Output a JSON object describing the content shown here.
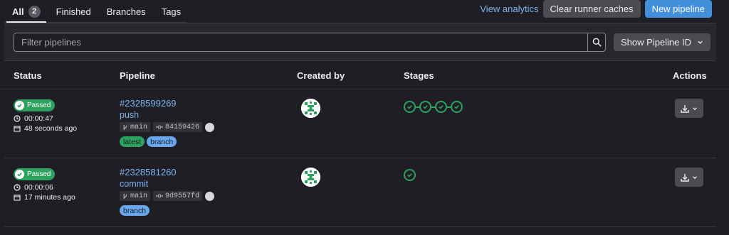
{
  "tabs": [
    {
      "label": "All",
      "count": "2"
    },
    {
      "label": "Finished"
    },
    {
      "label": "Branches"
    },
    {
      "label": "Tags"
    }
  ],
  "actions": {
    "view_analytics": "View analytics",
    "clear_caches": "Clear runner caches",
    "new_pipeline": "New pipeline"
  },
  "filter": {
    "placeholder": "Filter pipelines",
    "show_id_label": "Show Pipeline ID"
  },
  "table": {
    "headers": [
      "Status",
      "Pipeline",
      "Created by",
      "Stages",
      "Actions"
    ],
    "rows": [
      {
        "status": "Passed",
        "duration": "00:00:47",
        "finished": "48 seconds ago",
        "pipeline_id": "#2328599269",
        "source": "push",
        "ref": "main",
        "commit": "84159426",
        "tags": [
          "latest",
          "branch"
        ],
        "stages": 4
      },
      {
        "status": "Passed",
        "duration": "00:00:06",
        "finished": "17 minutes ago",
        "pipeline_id": "#2328581260",
        "source": "commit",
        "ref": "main",
        "commit": "9d9557fd",
        "tags": [
          "branch"
        ],
        "stages": 1
      }
    ]
  },
  "colors": {
    "background": "#1f1e24",
    "success": "#2da160",
    "link": "#7cb3f2",
    "primary": "#428fdc"
  },
  "icons": [
    "check-circle-icon",
    "clock-icon",
    "calendar-icon",
    "branch-icon",
    "commit-icon",
    "search-icon",
    "chevron-down-icon",
    "download-icon",
    "identicon-avatar"
  ]
}
